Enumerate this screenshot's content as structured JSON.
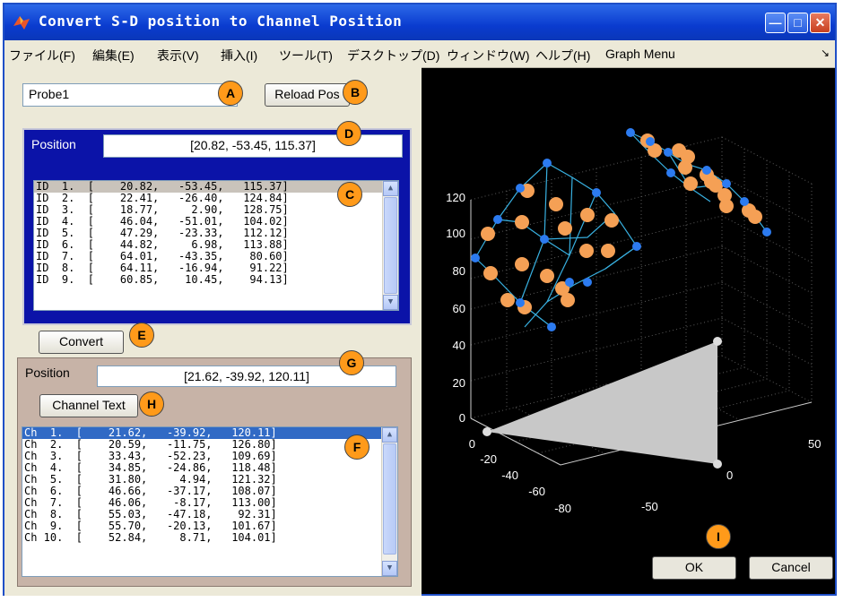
{
  "window": {
    "title": "Convert S-D position to Channel Position"
  },
  "menu": [
    "ファイル(F)",
    "編集(E)",
    "表示(V)",
    "挿入(I)",
    "ツール(T)",
    "デスクトップ(D)",
    "ウィンドウ(W)",
    "ヘルプ(H)",
    "Graph Menu"
  ],
  "probe": {
    "name": "Probe1",
    "reload_label": "Reload Pos"
  },
  "sd": {
    "position_label": "Position",
    "position_value": "[20.82, -53.45, 115.37]",
    "rows": [
      "ID  1.  [    20.82,   -53.45,   115.37]",
      "ID  2.  [    22.41,   -26.40,   124.84]",
      "ID  3.  [    18.77,     2.90,   128.75]",
      "ID  4.  [    46.04,   -51.01,   104.02]",
      "ID  5.  [    47.29,   -23.33,   112.12]",
      "ID  6.  [    44.82,     6.98,   113.88]",
      "ID  7.  [    64.01,   -43.35,    80.60]",
      "ID  8.  [    64.11,   -16.94,    91.22]",
      "ID  9.  [    60.85,    10.45,    94.13]"
    ],
    "convert_label": "Convert"
  },
  "channel": {
    "position_label": "Position",
    "position_value": "[21.62, -39.92, 120.11]",
    "channel_text_label": "Channel Text",
    "rows": [
      "Ch  1.  [    21.62,   -39.92,   120.11]",
      "Ch  2.  [    20.59,   -11.75,   126.80]",
      "Ch  3.  [    33.43,   -52.23,   109.69]",
      "Ch  4.  [    34.85,   -24.86,   118.48]",
      "Ch  5.  [    31.80,     4.94,   121.32]",
      "Ch  6.  [    46.66,   -37.17,   108.07]",
      "Ch  7.  [    46.06,    -8.17,   113.00]",
      "Ch  8.  [    55.03,   -47.18,    92.31]",
      "Ch  9.  [    55.70,   -20.13,   101.67]",
      "Ch 10.  [    52.84,     8.71,   104.01]"
    ]
  },
  "plot": {
    "z_ticks": [
      "0",
      "20",
      "40",
      "60",
      "80",
      "100",
      "120"
    ],
    "y_ticks": [
      "0",
      "-20",
      "-40",
      "-60",
      "-80"
    ],
    "x_ticks": [
      "50",
      "0",
      "-50"
    ]
  },
  "buttons": {
    "ok": "OK",
    "cancel": "Cancel"
  },
  "callouts": [
    "A",
    "B",
    "C",
    "D",
    "E",
    "F",
    "G",
    "H",
    "I"
  ],
  "colors": {
    "title_bar": "#0a3bcf",
    "sd_panel": "#0b13a8",
    "channel_panel": "#c7b3a7",
    "optode": "#f5a055",
    "source": "#2c7bf0",
    "link": "#38b0e0",
    "plot_bg": "#000000"
  }
}
